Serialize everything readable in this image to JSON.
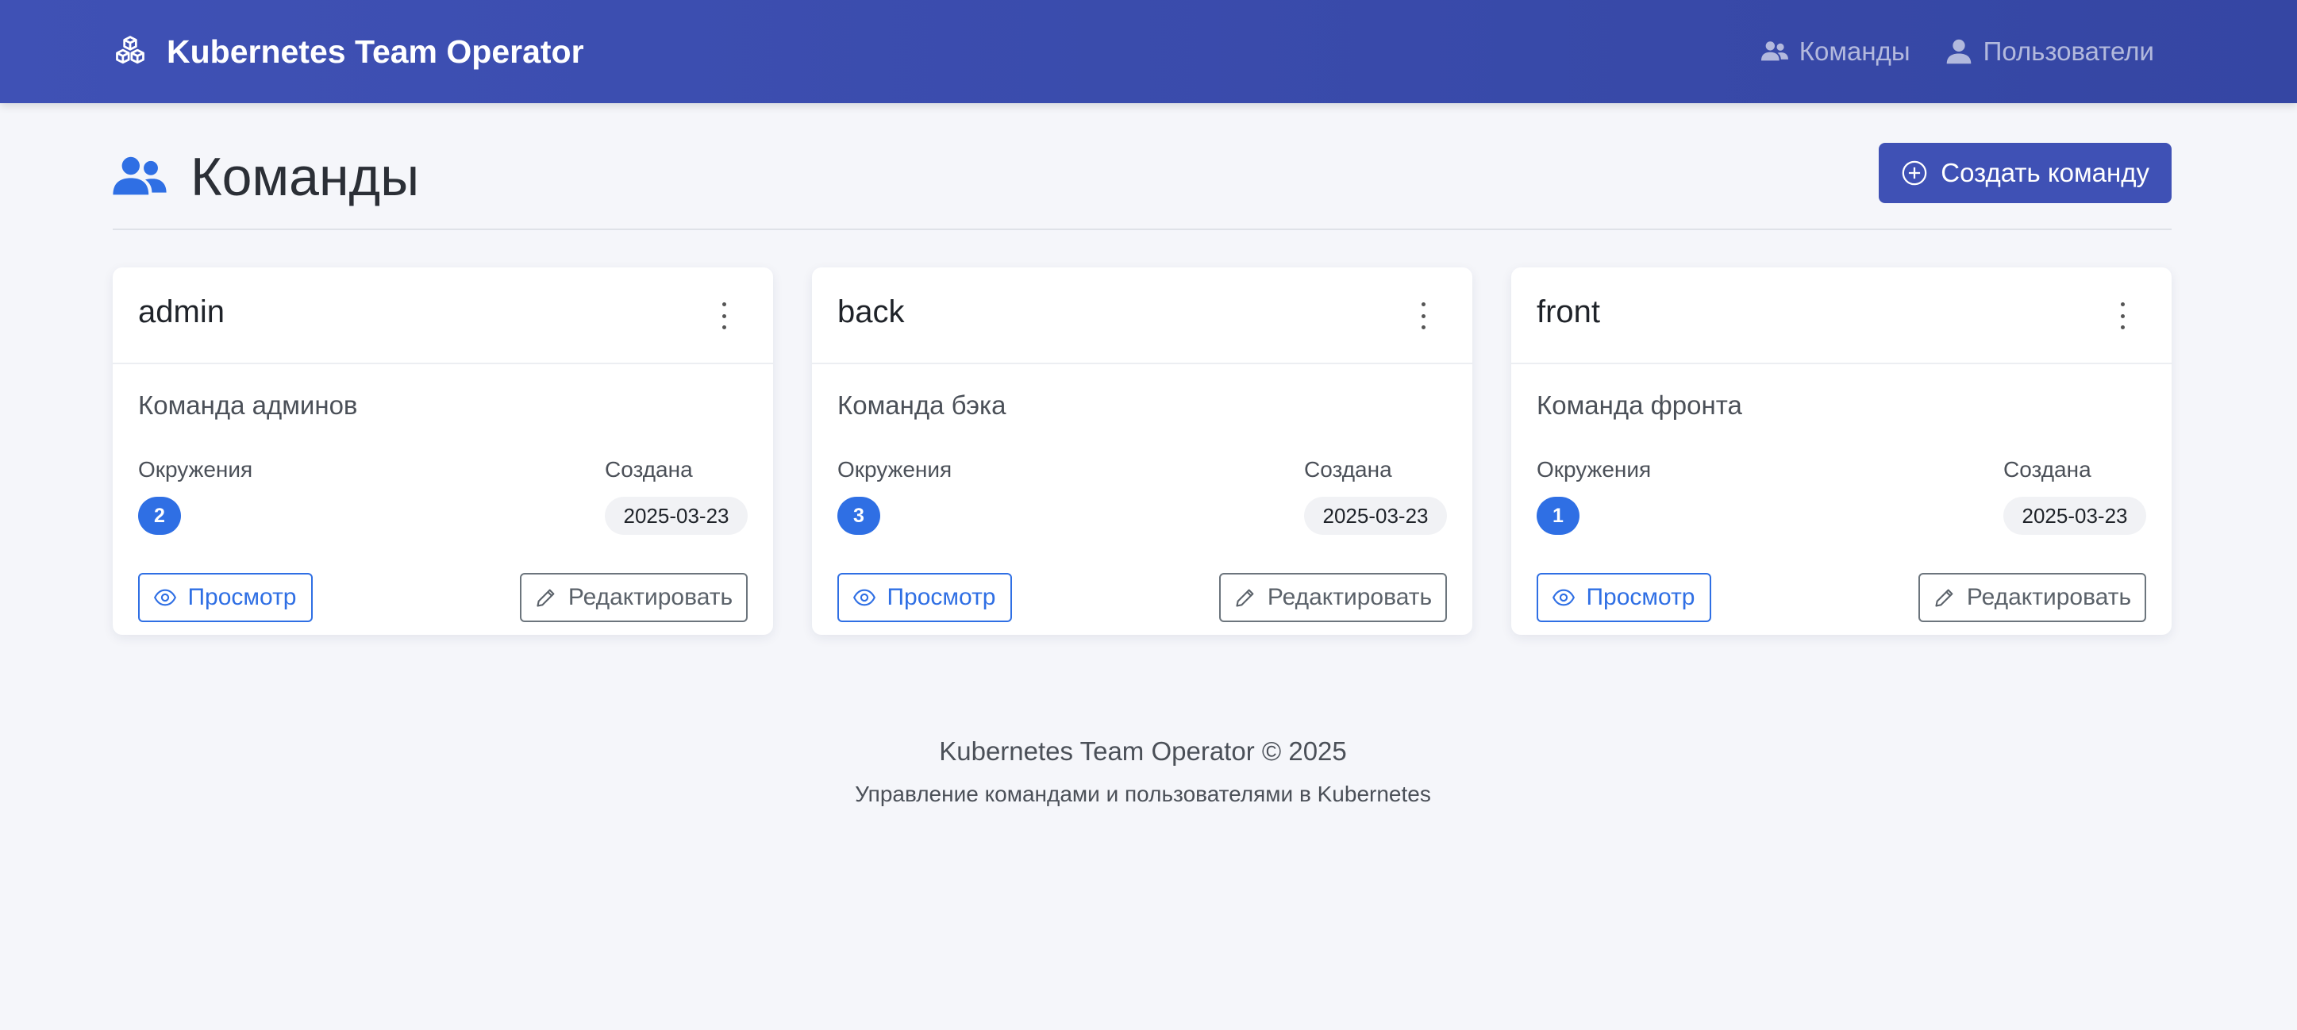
{
  "navbar": {
    "brand": "Kubernetes Team Operator",
    "brand_icon": "boxes-icon",
    "links": [
      {
        "label": "Команды",
        "icon": "people-icon"
      },
      {
        "label": "Пользователи",
        "icon": "person-icon"
      }
    ]
  },
  "page": {
    "title": "Команды",
    "title_icon": "people-icon",
    "create_button": "Создать команду"
  },
  "labels": {
    "environments": "Окружения",
    "created": "Создана",
    "view": "Просмотр",
    "edit": "Редактировать"
  },
  "teams": [
    {
      "name": "admin",
      "description": "Команда админов",
      "environments": "2",
      "created": "2025-03-23"
    },
    {
      "name": "back",
      "description": "Команда бэка",
      "environments": "3",
      "created": "2025-03-23"
    },
    {
      "name": "front",
      "description": "Команда фронта",
      "environments": "1",
      "created": "2025-03-23"
    }
  ],
  "footer": {
    "title": "Kubernetes Team Operator © 2025",
    "subtitle": "Управление командами и пользователями в Kubernetes"
  },
  "colors": {
    "navbar": "#3f51b5",
    "primary": "#2f6fe4",
    "background": "#f5f6fa"
  }
}
